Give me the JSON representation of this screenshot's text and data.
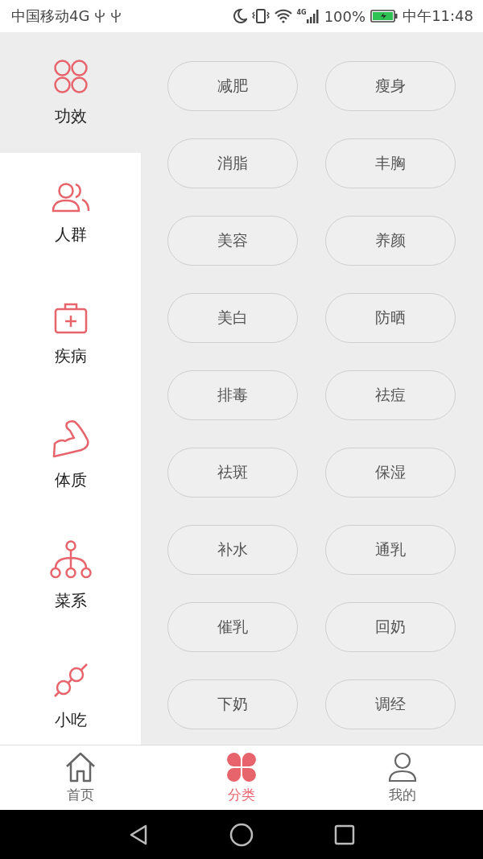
{
  "status_bar": {
    "carrier": "中国移动4G",
    "network": "4G",
    "battery": "100%",
    "time": "中午11:48"
  },
  "sidebar": {
    "items": [
      {
        "label": "功效",
        "selected": true
      },
      {
        "label": "人群",
        "selected": false
      },
      {
        "label": "疾病",
        "selected": false
      },
      {
        "label": "体质",
        "selected": false
      },
      {
        "label": "菜系",
        "selected": false
      },
      {
        "label": "小吃",
        "selected": false
      }
    ]
  },
  "tags": [
    "减肥",
    "瘦身",
    "消脂",
    "丰胸",
    "美容",
    "养颜",
    "美白",
    "防晒",
    "排毒",
    "祛痘",
    "祛斑",
    "保湿",
    "补水",
    "通乳",
    "催乳",
    "回奶",
    "下奶",
    "调经"
  ],
  "tab_bar": [
    {
      "label": "首页",
      "selected": false
    },
    {
      "label": "分类",
      "selected": true
    },
    {
      "label": "我的",
      "selected": false
    }
  ]
}
